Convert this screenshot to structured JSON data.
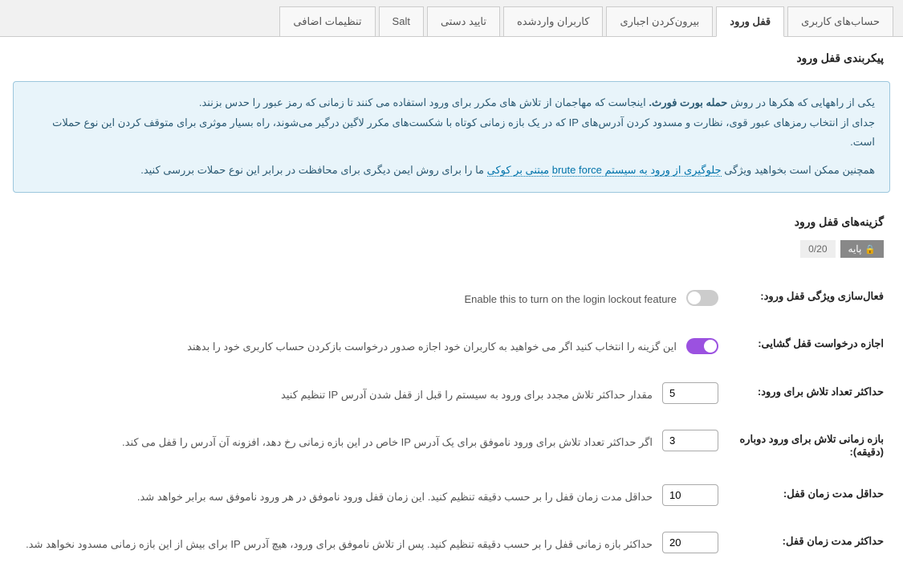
{
  "tabs": [
    {
      "label": "حساب‌های کاربری",
      "active": false
    },
    {
      "label": "قفل ورود",
      "active": true
    },
    {
      "label": "بیرون‌کردن اجباری",
      "active": false
    },
    {
      "label": "کاربران واردشده",
      "active": false
    },
    {
      "label": "تایید دستی",
      "active": false
    },
    {
      "label": "Salt",
      "active": false
    },
    {
      "label": "تنظیمات اضافی",
      "active": false
    }
  ],
  "section_title": "پیکربندی قفل ورود",
  "notice": {
    "line1_a": "یکی از راههایی که هکرها در روش ",
    "line1_bold": "حمله بورت فورث.",
    "line1_b": " اینجاست که مهاجمان از تلاش های مکرر برای ورود استفاده می کنند تا زمانی که رمز عبور را حدس بزنند.",
    "line2": "جدای از انتخاب رمزهای عبور قوی، نظارت و مسدود کردن آدرس‌های IP که در یک بازه زمانی کوتاه با شکست‌های مکرر لاگین درگیر می‌شوند، راه بسیار موثری برای متوقف کردن این نوع حملات است.",
    "line3_a": "همچنین ممکن است بخواهید ویژگی ",
    "line3_link1": "جلوگیری از ورود به سیستم brute force",
    "line3_b": " ",
    "line3_link2": "مبتنی بر کوکی",
    "line3_c": " ما را برای روش ایمن دیگری برای محافظت در برابر این نوع حملات بررسی کنید."
  },
  "options_title": "گزینه‌های قفل ورود",
  "badge": {
    "label": "پایه",
    "score": "0/20"
  },
  "rows": {
    "enable": {
      "label": "فعال‌سازی ویژگی قفل ورود:",
      "hint": "Enable this to turn on the login lockout feature",
      "value": false
    },
    "allow_unlock": {
      "label": "اجازه درخواست قفل گشایی:",
      "hint": "این گزینه را انتخاب کنید اگر می خواهید به کاربران خود اجازه صدور درخواست بازکردن حساب کاربری خود را بدهند",
      "value": true
    },
    "max_attempts": {
      "label": "حداکثر تعداد تلاش برای ورود:",
      "hint": "مقدار حداکثر تلاش مجدد برای ورود به سیستم را قبل از قفل شدن آدرس IP تنظیم کنید",
      "value": "5"
    },
    "retry_period": {
      "label": "بازه زمانی تلاش برای ورود دوباره (دقیقه):",
      "hint": "اگر حداکثر تعداد تلاش برای ورود ناموفق برای یک آدرس IP خاص در این بازه زمانی رخ دهد، افزونه آن آدرس را قفل می کند.",
      "value": "3"
    },
    "min_lockout": {
      "label": "حداقل مدت زمان قفل:",
      "hint": "حداقل مدت زمان قفل را بر حسب دقیقه تنظیم کنید. این زمان قفل ورود ناموفق در هر ورود ناموفق سه برابر خواهد شد.",
      "value": "10"
    },
    "max_lockout": {
      "label": "حداکثر مدت زمان قفل:",
      "hint": "حداکثر بازه زمانی قفل را بر حسب دقیقه تنظیم کنید. پس از تلاش ناموفق برای ورود، هیچ آدرس IP برای بیش از این بازه زمانی مسدود نخواهد شد.",
      "value": "20"
    }
  }
}
